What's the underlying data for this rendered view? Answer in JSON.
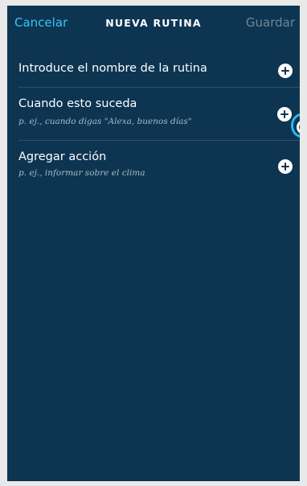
{
  "header": {
    "cancel_label": "Cancelar",
    "title": "NUEVA RUTINA",
    "save_label": "Guardar"
  },
  "rows": [
    {
      "title": "Introduce el nombre de la rutina",
      "subtitle": ""
    },
    {
      "title": "Cuando esto suceda",
      "subtitle": "p. ej., cuando digas \"Alexa, buenos días\""
    },
    {
      "title": "Agregar acción",
      "subtitle": "p. ej., informar sobre el clima"
    }
  ],
  "icons": {
    "add": "plus-circle-icon",
    "cursor": "touch-indicator-icon"
  },
  "colors": {
    "background": "#0d3552",
    "accent": "#35c6f4",
    "disabled": "#6f8799",
    "text": "#ffffff",
    "subtitle": "#a6bac8",
    "divider": "#2e5069"
  }
}
